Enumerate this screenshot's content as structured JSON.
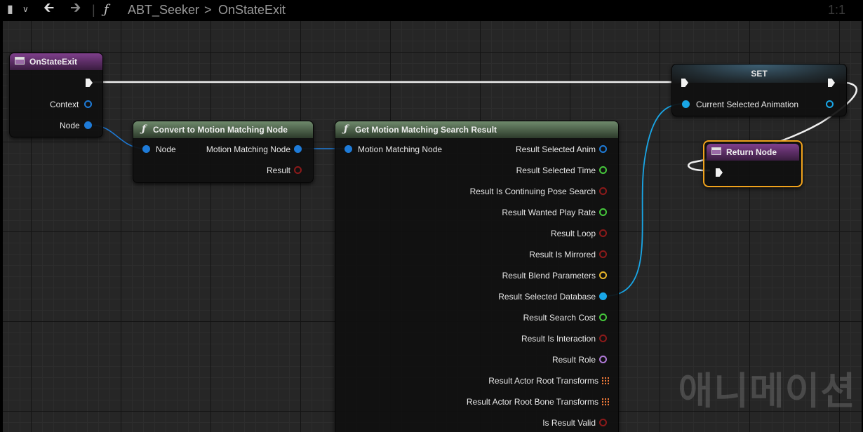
{
  "toolbar": {
    "bookmark_icon": "bookmark-icon",
    "back_icon": "arrow-left-icon",
    "forward_icon": "arrow-right-icon",
    "function_glyph": "ƒ",
    "breadcrumb_parent": "ABT_Seeker",
    "breadcrumb_sep": ">",
    "breadcrumb_current": "OnStateExit",
    "zoom": "1:1"
  },
  "nodes": {
    "on_state_exit": {
      "title": "OnStateExit",
      "pins": [
        "Context",
        "Node"
      ]
    },
    "convert": {
      "title": "Convert to Motion Matching Node",
      "inputs": [
        "Node"
      ],
      "outputs": [
        "Motion Matching Node",
        "Result"
      ]
    },
    "get_result": {
      "title": "Get Motion Matching Search Result",
      "inputs": [
        "Motion Matching Node"
      ],
      "outputs": [
        "Result Selected Anim",
        "Result Selected Time",
        "Result Is Continuing Pose Search",
        "Result Wanted Play Rate",
        "Result Loop",
        "Result Is Mirrored",
        "Result Blend Parameters",
        "Result Selected Database",
        "Result Search Cost",
        "Result Is Interaction",
        "Result Role",
        "Result Actor Root Transforms",
        "Result Actor Root Bone Transforms",
        "Is Result Valid"
      ]
    },
    "set": {
      "title": "SET",
      "pins": [
        "Current Selected Animation"
      ]
    },
    "return": {
      "title": "Return Node"
    }
  },
  "watermark": "애니메이션",
  "colors": {
    "object_pin": "#1e7bd8",
    "float_pin": "#46c83c",
    "bool_pin": "#8c1a1a",
    "struct_pin": "#e8b52a",
    "name_pin": "#b07ad8",
    "array_pin": "#f07a3a",
    "database_pin": "#19a6e6",
    "selection": "#f0a21c"
  }
}
